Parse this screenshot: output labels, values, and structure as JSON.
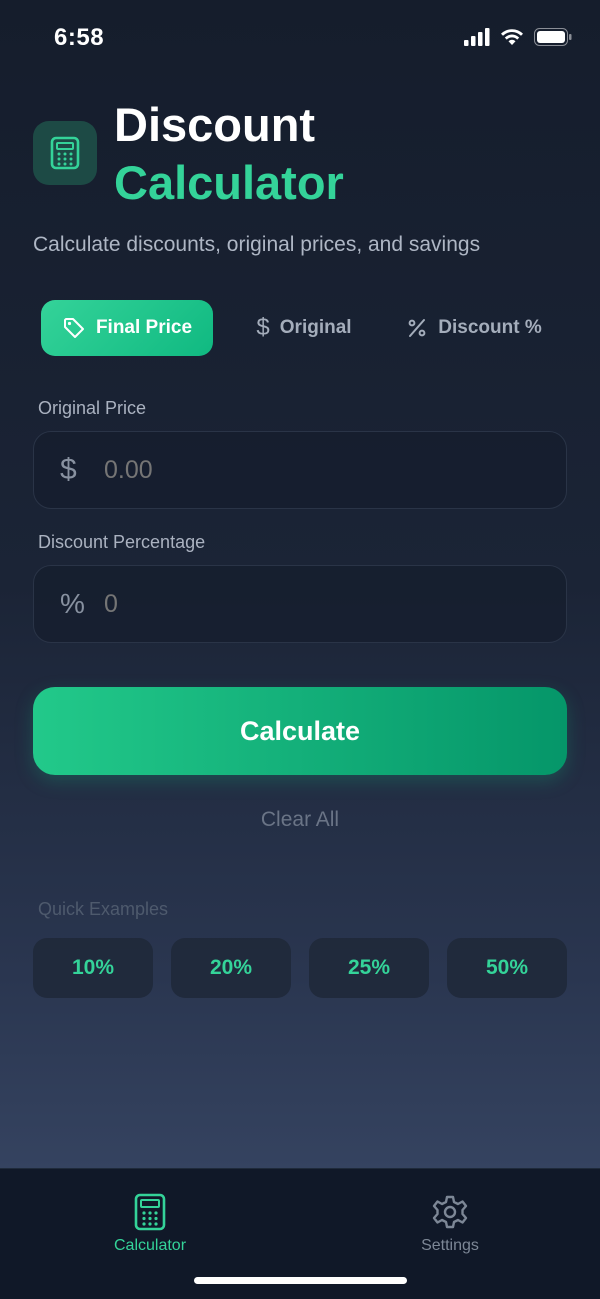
{
  "status_bar": {
    "time": "6:58"
  },
  "header": {
    "title_line1": "Discount",
    "title_line2": "Calculator",
    "subtitle": "Calculate discounts, original prices, and savings"
  },
  "mode_tabs": [
    {
      "label": "Final Price",
      "icon": "tag-icon",
      "active": true
    },
    {
      "label": "Original",
      "icon": "dollar-icon",
      "active": false
    },
    {
      "label": "Discount %",
      "icon": "percent-icon",
      "active": false
    }
  ],
  "fields": {
    "original_price": {
      "label": "Original Price",
      "icon_glyph": "$",
      "placeholder": "0.00"
    },
    "discount_percentage": {
      "label": "Discount Percentage",
      "icon_glyph": "%",
      "placeholder": "0"
    }
  },
  "actions": {
    "calculate_label": "Calculate",
    "clear_label": "Clear All"
  },
  "quick_examples": {
    "title": "Quick Examples",
    "items": [
      "10%",
      "20%",
      "25%",
      "50%"
    ]
  },
  "bottom_nav": [
    {
      "label": "Calculator",
      "icon": "calculator-icon",
      "active": true
    },
    {
      "label": "Settings",
      "icon": "gear-icon",
      "active": false
    }
  ],
  "colors": {
    "accent": "#34d399",
    "accent_dark": "#059669",
    "background_top": "#151d2c",
    "background_bottom": "#354360"
  }
}
